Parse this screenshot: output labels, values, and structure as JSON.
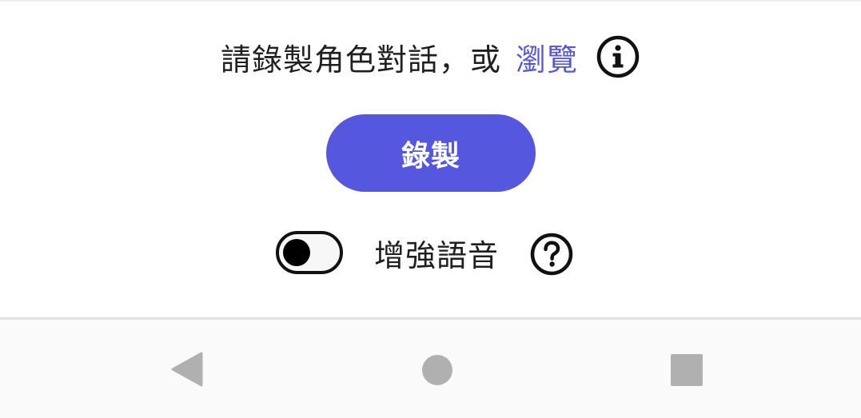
{
  "prompt": {
    "text": "請錄製角色對話，或",
    "browse_link": "瀏覽",
    "info_icon": "info-circle-icon"
  },
  "record_button": {
    "label": "錄製",
    "color": "#5558df"
  },
  "enhance_voice": {
    "label": "增強語音",
    "toggle_on": false,
    "help_icon": "question-circle-icon"
  },
  "nav_bar": {
    "back_icon": "triangle-back-icon",
    "home_icon": "circle-home-icon",
    "recents_icon": "square-recents-icon"
  },
  "colors": {
    "accent": "#5558df",
    "link": "#5558d6",
    "text": "#1f1f1f",
    "nav_icons": "#b0b0b0"
  }
}
